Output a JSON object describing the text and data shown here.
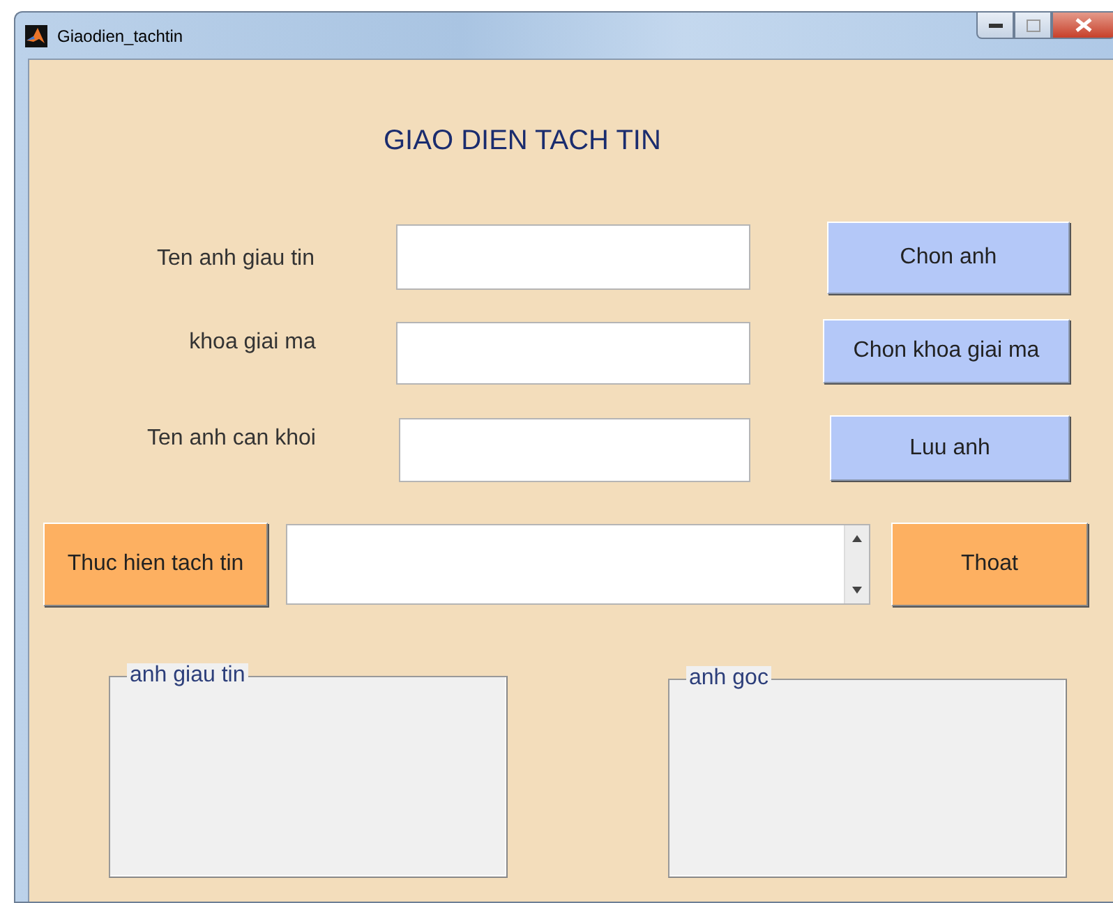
{
  "window": {
    "title": "Giaodien_tachtin"
  },
  "heading": "GIAO DIEN TACH TIN",
  "rows": [
    {
      "label": "Ten anh giau tin",
      "button": "Chon anh"
    },
    {
      "label": "khoa giai ma",
      "button": "Chon khoa giai ma"
    },
    {
      "label": "Ten anh can khoi",
      "button": "Luu anh"
    }
  ],
  "action_button": "Thuc hien tach tin",
  "exit_button": "Thoat",
  "panels": [
    {
      "title": "anh giau tin"
    },
    {
      "title": "anh goc"
    }
  ]
}
